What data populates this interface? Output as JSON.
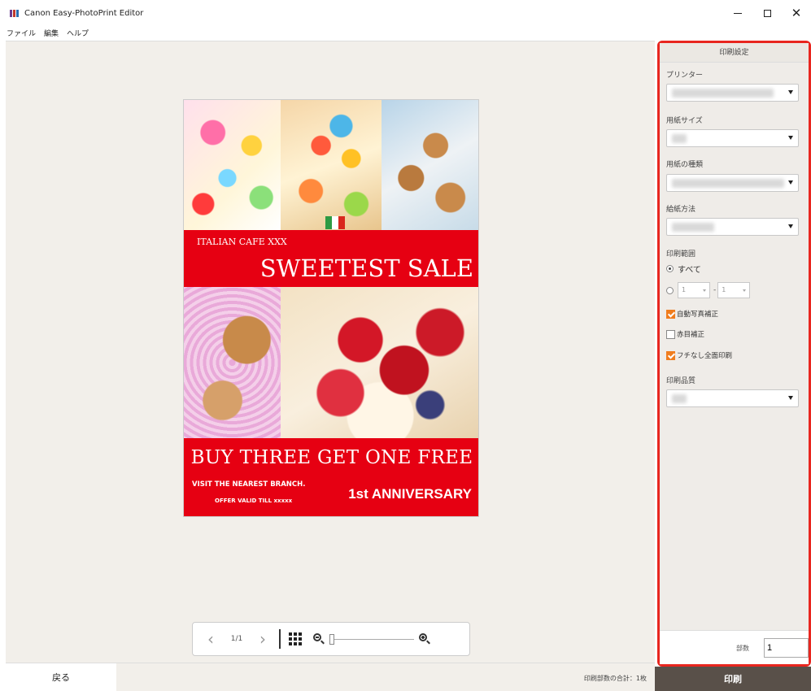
{
  "window": {
    "title": "Canon Easy-PhotoPrint Editor",
    "minimize": "–",
    "maximize": "",
    "close": "✕"
  },
  "menu": [
    "ファイル",
    "編集",
    "ヘルプ"
  ],
  "poster": {
    "cafe": "ITALIAN CAFE XXX",
    "headline": "SWEETEST SALE",
    "promo": "BUY THREE GET ONE FREE",
    "visit": "VISIT THE NEAREST BRANCH.",
    "offer": "OFFER VALID TILL xxxxx",
    "anniversary": "1st ANNIVERSARY"
  },
  "zoombar": {
    "prev": "‹",
    "page": "1/1",
    "next": "›"
  },
  "back_label": "戻る",
  "total_copies": "印刷部数の合計：1枚",
  "print_settings": {
    "header": "印刷設定",
    "printer_label": "プリンター",
    "paper_size_label": "用紙サイズ",
    "media_type_label": "用紙の種類",
    "paper_source_label": "給紙方法",
    "range_label": "印刷範囲",
    "range_all": "すべて",
    "range_from": "1",
    "range_dash": "-",
    "range_to": "1",
    "auto_correct_label": "自動写真補正",
    "red_eye_label": "赤目補正",
    "borderless_label": "フチなし全面印刷",
    "quality_label": "印刷品質",
    "copies_label": "部数",
    "copies_value": "1",
    "auto_correct_checked": true,
    "red_eye_checked": false,
    "borderless_checked": true
  },
  "print_button": "印刷",
  "colors": {
    "poster_red": "#e60012",
    "panel_border": "#e8261f",
    "checkbox_orange": "#f07d1e",
    "print_button_bg": "#595049"
  }
}
